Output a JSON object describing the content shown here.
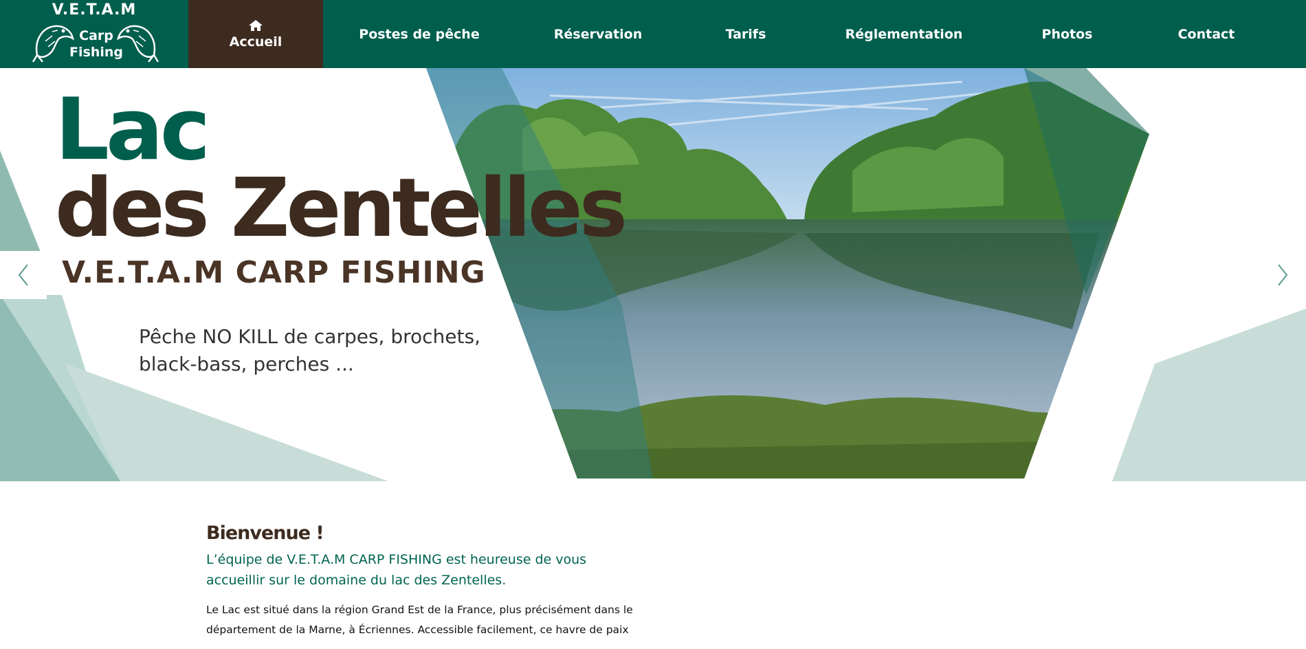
{
  "header": {
    "logo": {
      "title": "V.E.T.A.M",
      "subtitle_line1": "Carp",
      "subtitle_line2": "Fishing"
    },
    "nav": [
      {
        "label": "Accueil",
        "active": true,
        "icon": "home-icon"
      },
      {
        "label": "Postes de pêche"
      },
      {
        "label": "Réservation"
      },
      {
        "label": "Tarifs"
      },
      {
        "label": "Réglementation"
      },
      {
        "label": "Photos"
      },
      {
        "label": "Contact"
      }
    ]
  },
  "hero": {
    "title_line1": "Lac",
    "title_line2": "des Zentelles",
    "subtitle": "V.E.T.A.M CARP FISHING",
    "description": "Pêche NO KILL de carpes, brochets, black-bass, perches ...",
    "prev_icon": "chevron-left-icon",
    "next_icon": "chevron-right-icon"
  },
  "welcome": {
    "title": "Bienvenue !",
    "lead": "L’équipe de V.E.T.A.M CARP FISHING est heureuse de vous accueillir sur le domaine du lac des Zentelles.",
    "body": "Le Lac est situé dans la région Grand Est de la France, plus précisément dans le département de la Marne, à Écriennes. Accessible facilement, ce havre de paix"
  },
  "colors": {
    "primary_green": "#005e4d",
    "brown": "#3d2b1f",
    "light_green": "#c8ddd8"
  }
}
